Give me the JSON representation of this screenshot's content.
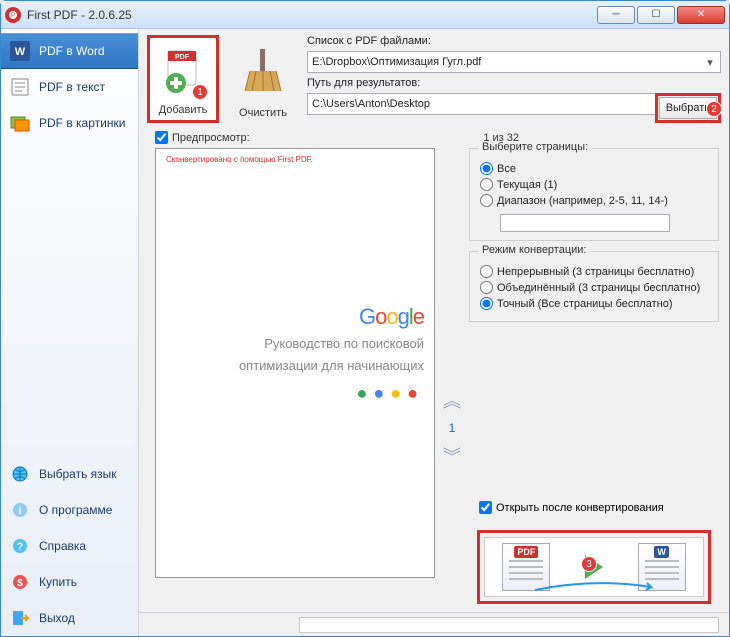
{
  "window": {
    "title": "First PDF - 2.0.6.25"
  },
  "sidebar": {
    "top": [
      {
        "label": "PDF в Word"
      },
      {
        "label": "PDF в текст"
      },
      {
        "label": "PDF в картинки"
      }
    ],
    "bottom": [
      {
        "label": "Выбрать язык"
      },
      {
        "label": "О программе"
      },
      {
        "label": "Справка"
      },
      {
        "label": "Купить"
      },
      {
        "label": "Выход"
      }
    ]
  },
  "toolbar": {
    "add": "Добавить",
    "clear": "Очистить",
    "files_label": "Список с PDF файлами:",
    "file_path": "E:\\Dropbox\\Оптимизация Гугл.pdf",
    "result_label": "Путь для результатов:",
    "result_path": "C:\\Users\\Anton\\Desktop",
    "browse": "Выбрать",
    "badge1": "1",
    "badge2": "2",
    "badge3": "3"
  },
  "preview": {
    "checkbox_label": "Предпросмотр:",
    "counter": "1 из 32",
    "generated_by": "Сконвертировано с помощью First PDF.",
    "doc_title_1": "Руководство по поисковой",
    "doc_title_2": "оптимизации для начинающих",
    "page_num": "1"
  },
  "pages_group": {
    "legend": "Выберите страницы:",
    "all": "Все",
    "current": "Текущая (1)",
    "range": "Диапазон (например, 2-5, 11, 14-)"
  },
  "mode_group": {
    "legend": "Режим конвертации:",
    "continuous": "Непрерывный (3 страницы бесплатно)",
    "merged": "Объединённый (3 страницы бесплатно)",
    "exact": "Точный (Все страницы бесплатно)"
  },
  "open_after": "Открыть после конвертирования",
  "doc_pdf": "PDF",
  "doc_w": "W"
}
